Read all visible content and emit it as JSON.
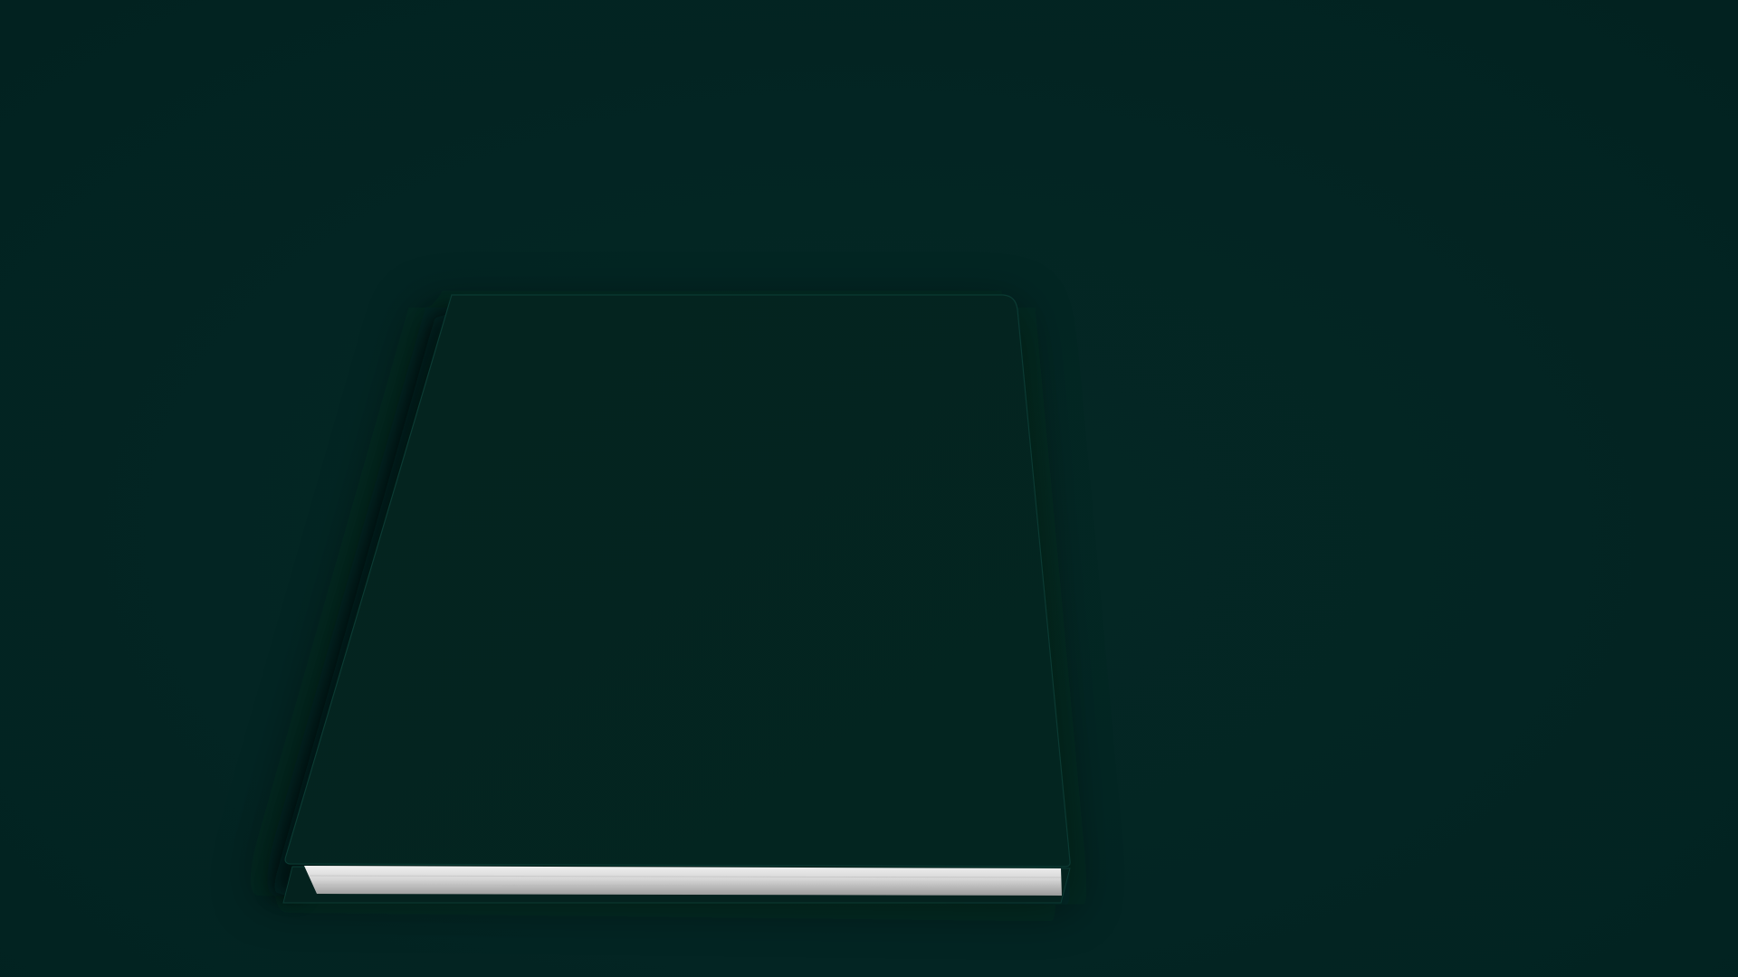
{
  "scene": {
    "subject": "closed-book-mockup",
    "colors": {
      "background": "#032523",
      "cover": "#04241f",
      "cover_edge": "#0a3a32",
      "pages": "#d9d9d9",
      "shadow": "#011513"
    }
  }
}
